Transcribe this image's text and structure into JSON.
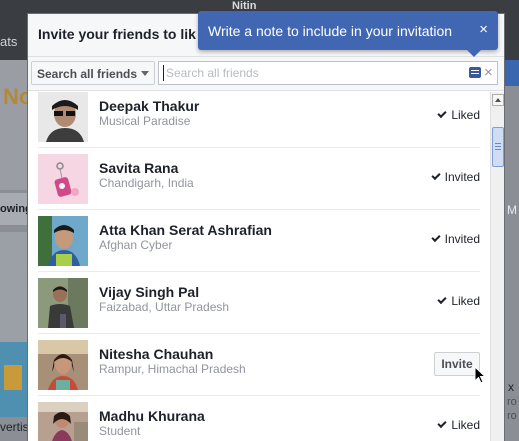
{
  "background": {
    "username": "Nitin",
    "left_fragments": [
      "ats",
      "No",
      "owing",
      "vertis"
    ],
    "right_fragments": [
      "M",
      "x",
      "ro",
      "ro"
    ]
  },
  "dialog": {
    "title": "Invite your friends to lik",
    "filter": {
      "selected": "Search all friends"
    },
    "search": {
      "placeholder": "Search all friends",
      "value": ""
    },
    "friends": [
      {
        "name": "Deepak Thakur",
        "subtitle": "Musical Paradise",
        "status": "Liked",
        "action": null
      },
      {
        "name": "Savita Rana",
        "subtitle": "Chandigarh, India",
        "status": "Invited",
        "action": null
      },
      {
        "name": "Atta Khan Serat Ashrafian",
        "subtitle": "Afghan Cyber",
        "status": "Invited",
        "action": null
      },
      {
        "name": "Vijay Singh Pal",
        "subtitle": "Faizabad, Uttar Pradesh",
        "status": "Liked",
        "action": null
      },
      {
        "name": "Nitesha Chauhan",
        "subtitle": "Rampur, Himachal Pradesh",
        "status": null,
        "action": "Invite"
      },
      {
        "name": "Madhu Khurana",
        "subtitle": "Student",
        "status": "Liked",
        "action": null
      }
    ]
  },
  "tooltip": {
    "text": "Write a note to include in your invitation",
    "close": "×"
  },
  "clear_search": "×",
  "colors": {
    "accent": "#4267b2",
    "header_bg": "#f6f7f9",
    "muted_text": "#90949c"
  }
}
